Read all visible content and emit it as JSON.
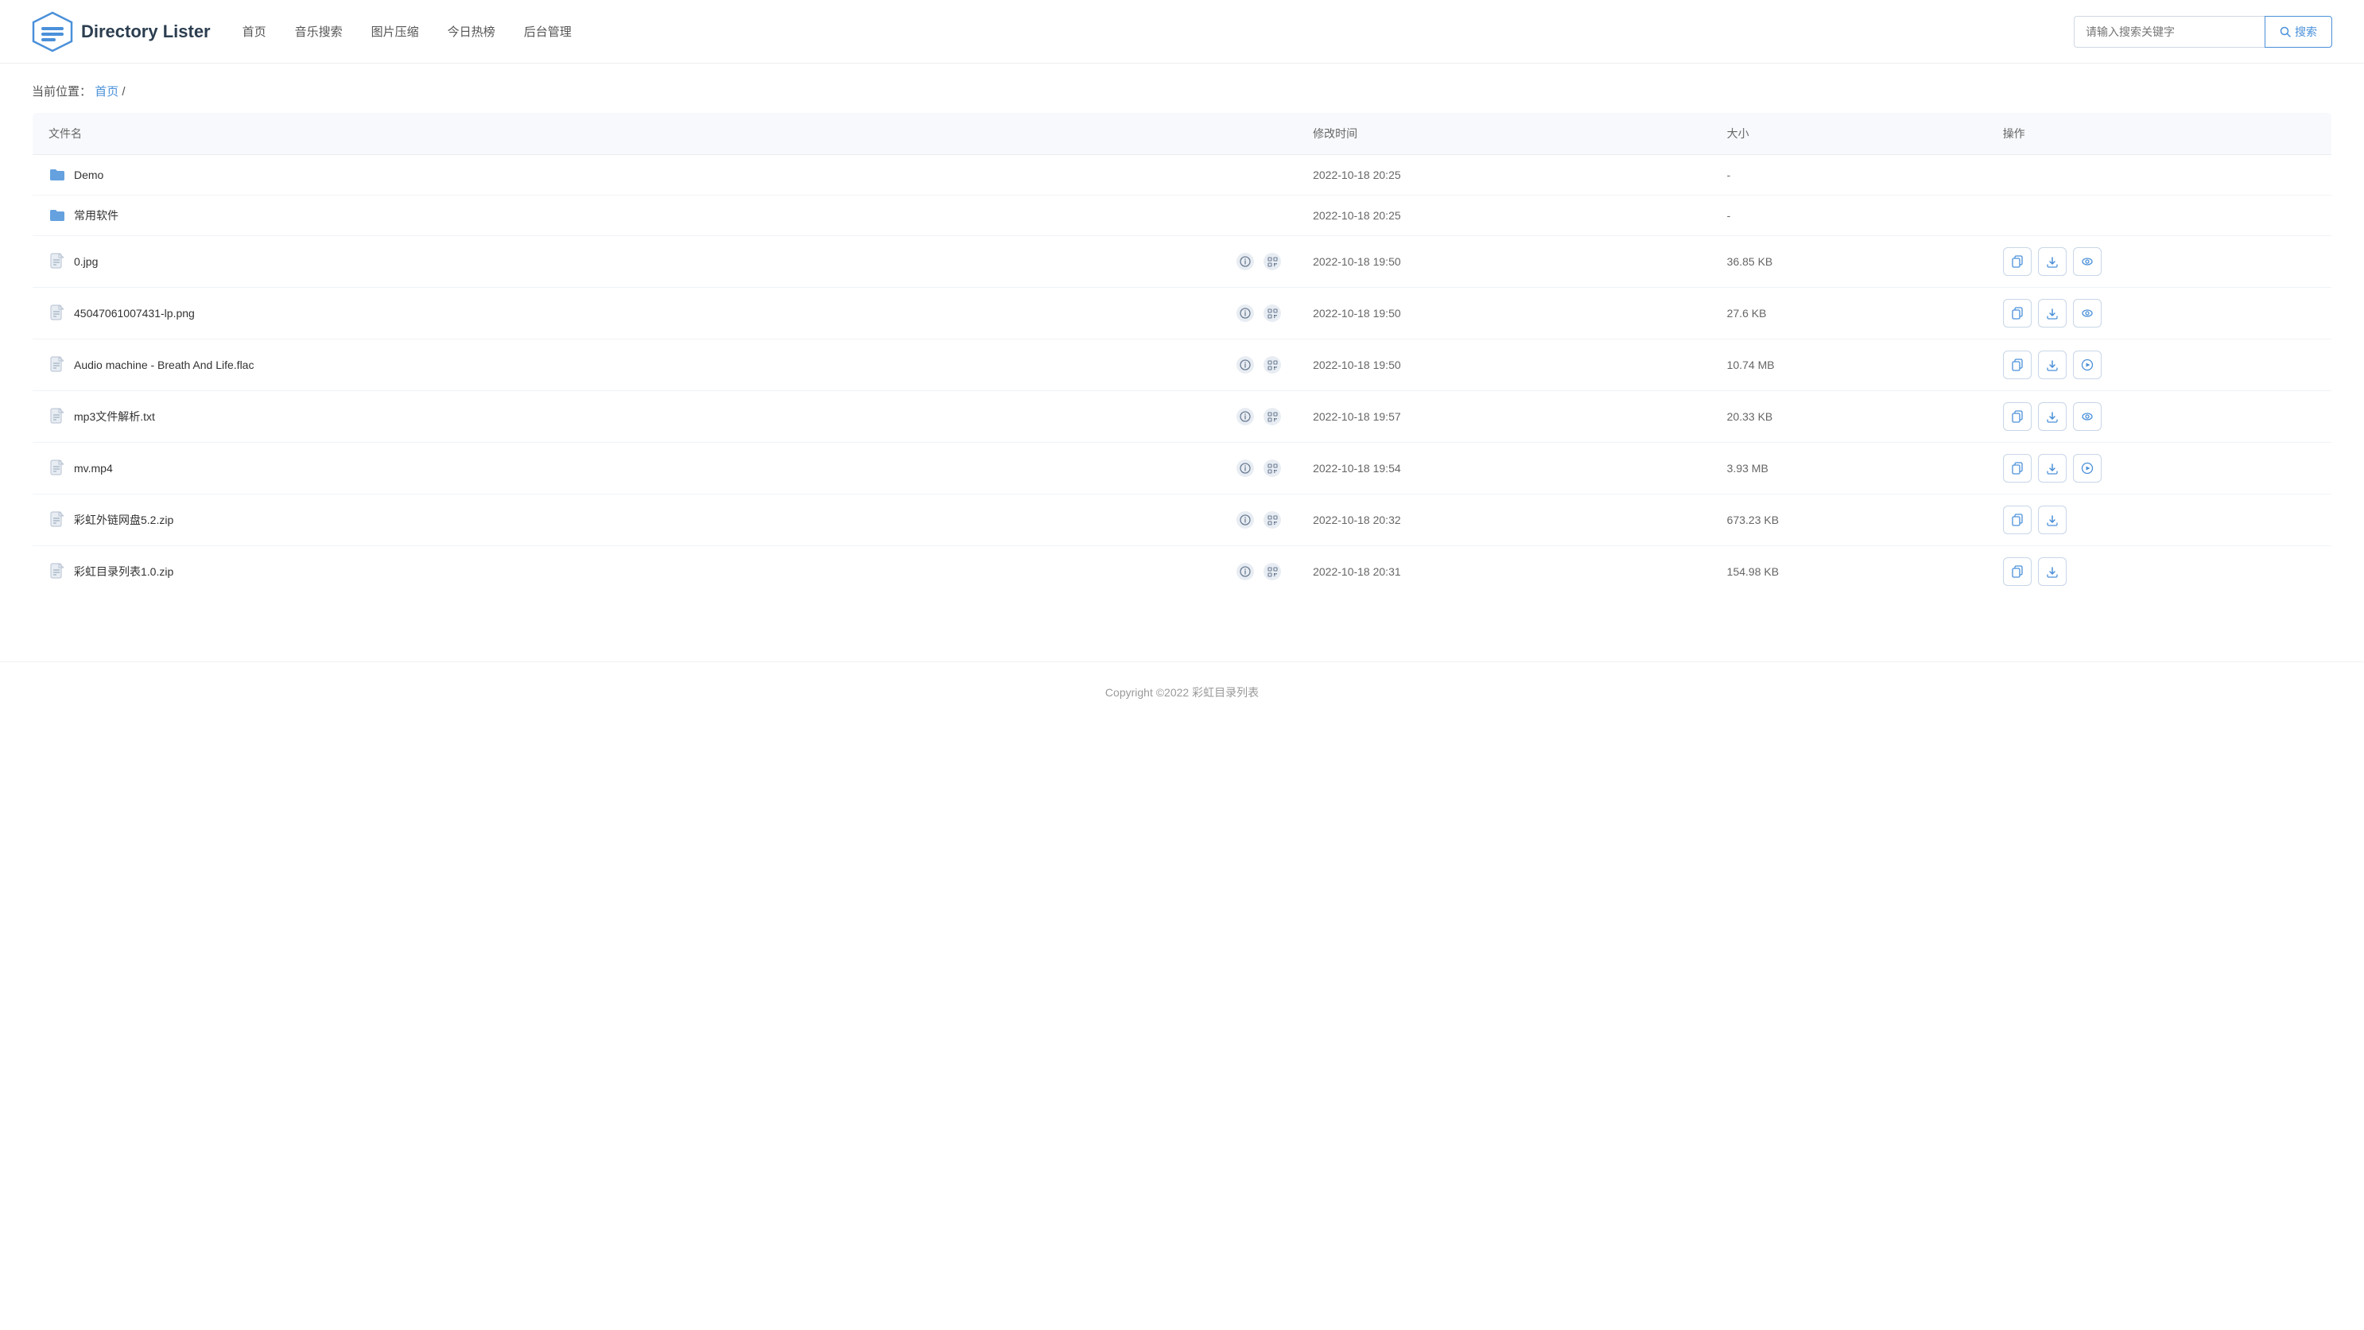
{
  "header": {
    "logo_text": "Directory Lister",
    "nav_items": [
      "首页",
      "音乐搜索",
      "图片压缩",
      "今日热榜",
      "后台管理"
    ],
    "search_placeholder": "请输入搜索关键字",
    "search_btn_label": "搜索"
  },
  "breadcrumb": {
    "prefix": "当前位置：",
    "home_label": "首页",
    "separator": "/"
  },
  "table": {
    "columns": [
      "文件名",
      "修改时间",
      "大小",
      "操作"
    ],
    "rows": [
      {
        "type": "folder",
        "name": "Demo",
        "modified": "2022-10-18 20:25",
        "size": "-",
        "actions": []
      },
      {
        "type": "folder",
        "name": "常用软件",
        "modified": "2022-10-18 20:25",
        "size": "-",
        "actions": []
      },
      {
        "type": "file",
        "name": "0.jpg",
        "modified": "2022-10-18 19:50",
        "size": "36.85 KB",
        "actions": [
          "copy",
          "download",
          "preview"
        ]
      },
      {
        "type": "file",
        "name": "45047061007431-lp.png",
        "modified": "2022-10-18 19:50",
        "size": "27.6 KB",
        "actions": [
          "copy",
          "download",
          "preview"
        ]
      },
      {
        "type": "file",
        "name": "Audio machine - Breath And Life.flac",
        "modified": "2022-10-18 19:50",
        "size": "10.74 MB",
        "actions": [
          "copy",
          "download",
          "play"
        ]
      },
      {
        "type": "file",
        "name": "mp3文件解析.txt",
        "modified": "2022-10-18 19:57",
        "size": "20.33 KB",
        "actions": [
          "copy",
          "download",
          "preview"
        ]
      },
      {
        "type": "file",
        "name": "mv.mp4",
        "modified": "2022-10-18 19:54",
        "size": "3.93 MB",
        "actions": [
          "copy",
          "download",
          "play"
        ]
      },
      {
        "type": "file",
        "name": "彩虹外链网盘5.2.zip",
        "modified": "2022-10-18 20:32",
        "size": "673.23 KB",
        "actions": [
          "copy",
          "download"
        ]
      },
      {
        "type": "file",
        "name": "彩虹目录列表1.0.zip",
        "modified": "2022-10-18 20:31",
        "size": "154.98 KB",
        "actions": [
          "copy",
          "download"
        ]
      }
    ]
  },
  "footer": {
    "text": "Copyright ©2022 彩虹目录列表"
  }
}
